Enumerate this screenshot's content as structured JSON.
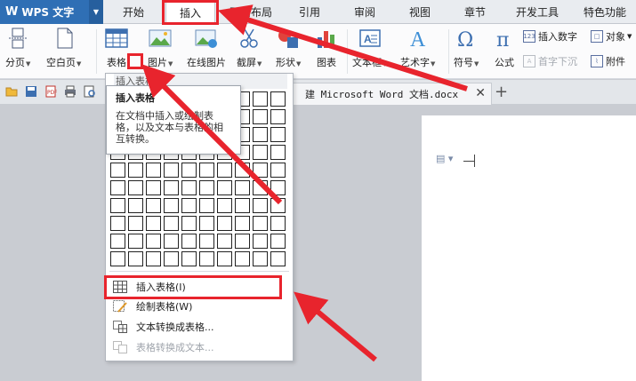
{
  "app": {
    "title": "WPS 文字"
  },
  "menu": [
    {
      "label": "开始"
    },
    {
      "label": "插入"
    },
    {
      "label": "页面布局"
    },
    {
      "label": "引用"
    },
    {
      "label": "审阅"
    },
    {
      "label": "视图"
    },
    {
      "label": "章节"
    },
    {
      "label": "开发工具"
    },
    {
      "label": "特色功能"
    }
  ],
  "ribbon": {
    "page_break": "分页",
    "blank_page": "空白页",
    "table": "表格",
    "picture": "图片",
    "online_picture": "在线图片",
    "screenshot": "截屏",
    "shapes": "形状",
    "chart": "图表",
    "textbox": "文本框",
    "wordart": "艺术字",
    "symbol": "符号",
    "formula": "公式",
    "insert_number": "插入数字",
    "object": "对象",
    "drop_cap": "首字下沉",
    "attachment": "附件"
  },
  "document_tab": {
    "title": "建 Microsoft Word 文档.docx"
  },
  "dropdown": {
    "grid_title": "插入表格",
    "items": [
      {
        "label": "插入表格(I)"
      },
      {
        "label": "绘制表格(W)"
      },
      {
        "label": "文本转换成表格..."
      },
      {
        "label": "表格转换成文本..."
      }
    ]
  },
  "tooltip": {
    "title": "插入表格",
    "body": "在文档中插入或绘制表格，以及文本与表格的相互转换。"
  },
  "colors": {
    "accent": "#2f6fb5",
    "highlight": "#e8242d"
  }
}
